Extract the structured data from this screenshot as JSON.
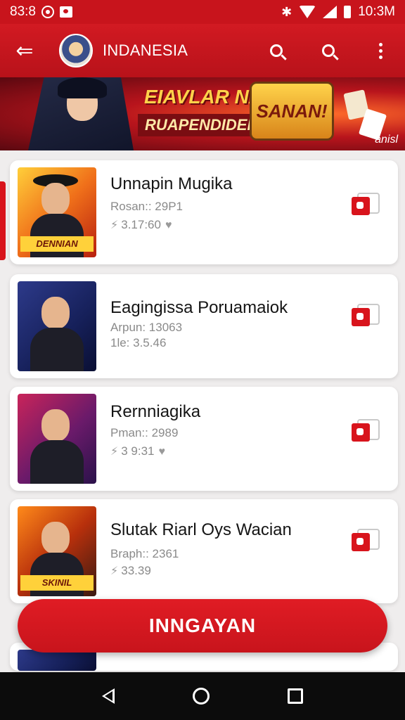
{
  "status_bar": {
    "time_left": "83:8",
    "time_right": "10:3M"
  },
  "app_bar": {
    "title": "INDANESIA"
  },
  "banner": {
    "headline": "EIAVLAR NAIS",
    "subline": "RUAPENDIDEN",
    "badge": "SANAN!",
    "signature": "anisl"
  },
  "cards": [
    {
      "title": "Unnapin Mugika",
      "meta1": "Rosan:: 29P1",
      "meta2": "3.17:60",
      "thumb_tag": "DENNIAN"
    },
    {
      "title": "Eagingissa Poruamaiok",
      "meta1": "Arpun: 13063",
      "meta2": "1le: 3.5.46",
      "thumb_tag": ""
    },
    {
      "title": "Rernniagika",
      "meta1": "Pman:: 2989",
      "meta2": "3 9:31",
      "thumb_tag": ""
    },
    {
      "title": "Slutak Riarl Oys Wacian",
      "meta1": "Braph:: 2361",
      "meta2": "33.39",
      "thumb_tag": "SKINIL"
    }
  ],
  "primary_button": {
    "label": "INNGAYAN"
  },
  "icons": {
    "menu": "menu-icon",
    "search": "search-icon",
    "more": "more-vert-icon",
    "rank": "rank-icon",
    "heart": "heart-icon",
    "action": "chat-icon"
  },
  "colors": {
    "brand_red": "#c8141c",
    "accent_red": "#d8141c"
  }
}
